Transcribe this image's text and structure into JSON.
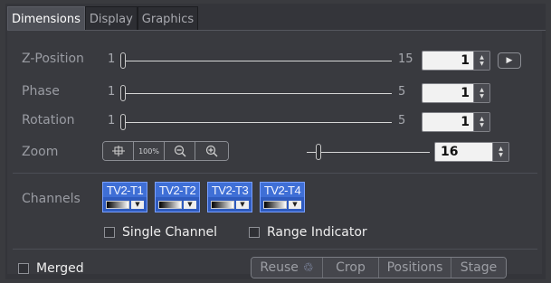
{
  "tabs": [
    {
      "label": "Dimensions"
    },
    {
      "label": "Display"
    },
    {
      "label": "Graphics"
    }
  ],
  "zposition": {
    "label": "Z-Position",
    "min": "1",
    "max": "15",
    "value": "1",
    "slider_fraction": 0.0
  },
  "phase": {
    "label": "Phase",
    "min": "1",
    "max": "5",
    "value": "1",
    "slider_fraction": 0.0
  },
  "rotation": {
    "label": "Rotation",
    "min": "1",
    "max": "5",
    "value": "1",
    "slider_fraction": 0.0
  },
  "zoom": {
    "label": "Zoom",
    "buttons": [
      "fit-icon",
      "100%",
      "zoom-out-icon",
      "zoom-in-icon"
    ],
    "pct_label": "100%",
    "value": "16",
    "slider_fraction": 0.12
  },
  "channels": {
    "label": "Channels",
    "items": [
      {
        "name": "TV2-T1"
      },
      {
        "name": "TV2-T2"
      },
      {
        "name": "TV2-T3"
      },
      {
        "name": "TV2-T4"
      }
    ]
  },
  "options": {
    "single_channel": "Single Channel",
    "range_indicator": "Range Indicator"
  },
  "bottom": {
    "merged": "Merged",
    "reuse": "Reuse",
    "crop": "Crop",
    "positions": "Positions",
    "stage": "Stage"
  },
  "colors": {
    "channel_blue": "#3f6fd6",
    "panel": "#393a3f",
    "active_tab": "#4e5057"
  }
}
